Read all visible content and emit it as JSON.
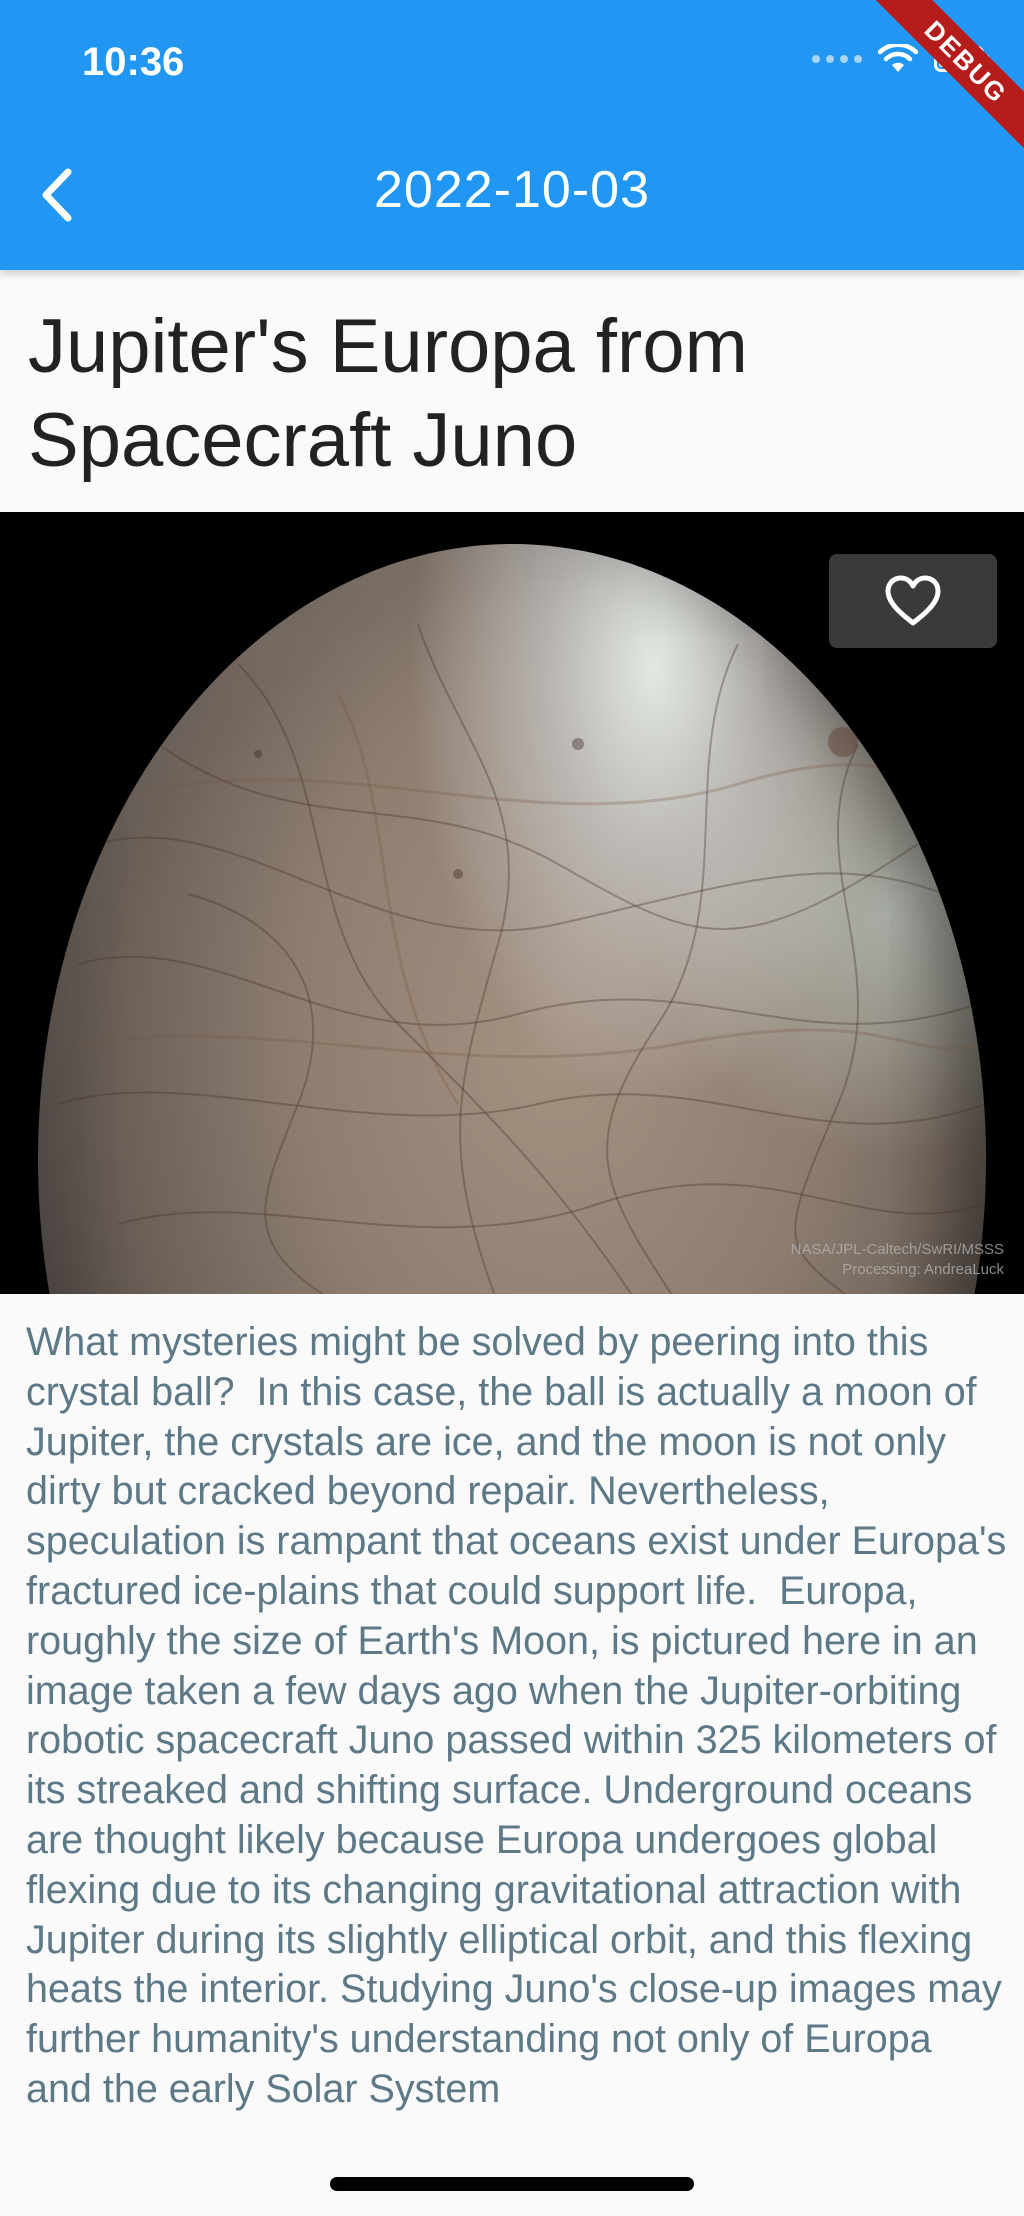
{
  "status_bar": {
    "time": "10:36"
  },
  "debug_banner": "DEBUG",
  "app_bar": {
    "title": "2022-10-03",
    "back_icon": "chevron-left-icon",
    "color": "#2196f3"
  },
  "apod": {
    "title": "Jupiter's Europa from Spacecraft Juno",
    "image": {
      "subject": "Jupiter's moon Europa",
      "credit_line_1": "NASA/JPL-Caltech/SwRI/MSSS",
      "credit_line_2": "Processing: AndreaLuck"
    },
    "favorite_icon": "heart-outline-icon",
    "explanation": "What mysteries might be solved by peering into this crystal ball?  In this case, the ball is actually a moon of Jupiter, the crystals are ice, and the moon is not only dirty but cracked beyond repair. Nevertheless, speculation is rampant that oceans exist under Europa's fractured ice-plains that could support life.  Europa, roughly the size of Earth's Moon, is pictured here in an image taken a few days ago when the Jupiter-orbiting robotic spacecraft Juno passed within 325 kilometers of its streaked and shifting surface. Underground oceans are thought likely because Europa undergoes global flexing due to its changing gravitational attraction with Jupiter during its slightly elliptical orbit, and this flexing heats the interior. Studying Juno's close-up images may further humanity's understanding not only of Europa and the early Solar System"
  }
}
